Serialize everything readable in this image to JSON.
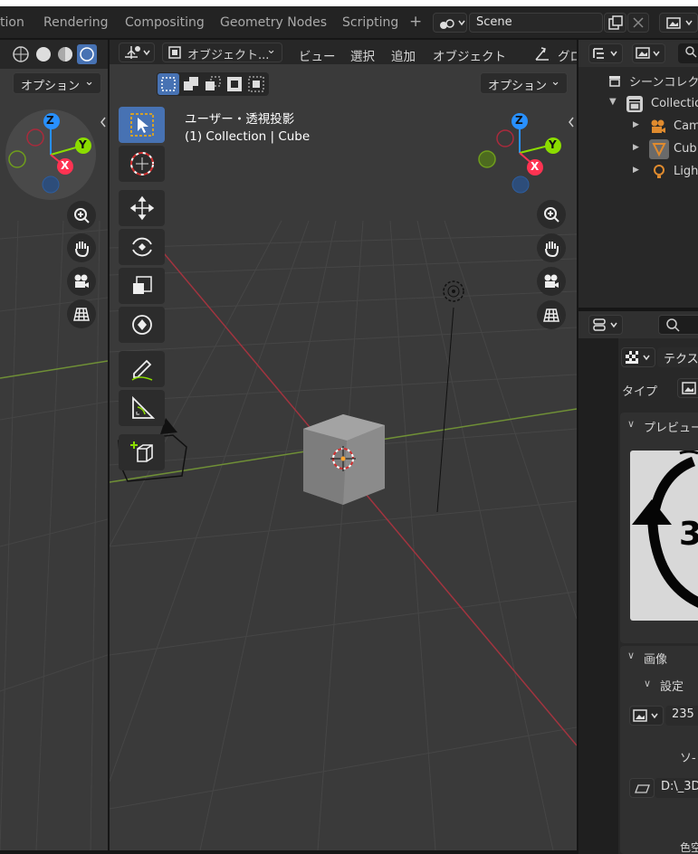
{
  "workspace_tabs": [
    "tion",
    "Rendering",
    "Compositing",
    "Geometry Nodes",
    "Scripting",
    "+"
  ],
  "scene": {
    "name": "Scene"
  },
  "left_view": {
    "options_label": "オプション"
  },
  "viewport": {
    "menus": [
      "オブジェクト...",
      "ビュー",
      "選択",
      "追加",
      "オブジェクト",
      "グロ"
    ],
    "options_label": "オプション",
    "view_name": "ユーザー・透視投影",
    "collection_label": "(1) Collection | Cube",
    "axes": {
      "x": "X",
      "y": "Y",
      "z": "Z"
    }
  },
  "outliner": {
    "scene_collection": "シーンコレク",
    "collection": "Collection",
    "items": [
      "Cam",
      "Cub",
      "Ligh"
    ]
  },
  "properties": {
    "texture_label": "テクス",
    "type_label": "タイプ",
    "preview_label": "プレビュー",
    "image_label": "画像",
    "settings_label": "設定",
    "image_name": "235",
    "source_label": "ソ-",
    "path": "D:\\_3D",
    "color_label": "色空",
    "preview_text": "3"
  },
  "colors": {
    "accent": "#4772b3",
    "x_axis": "#ff3352",
    "y_axis": "#8bdc00",
    "z_axis": "#2890ff",
    "grid": "#4a4a4a"
  }
}
